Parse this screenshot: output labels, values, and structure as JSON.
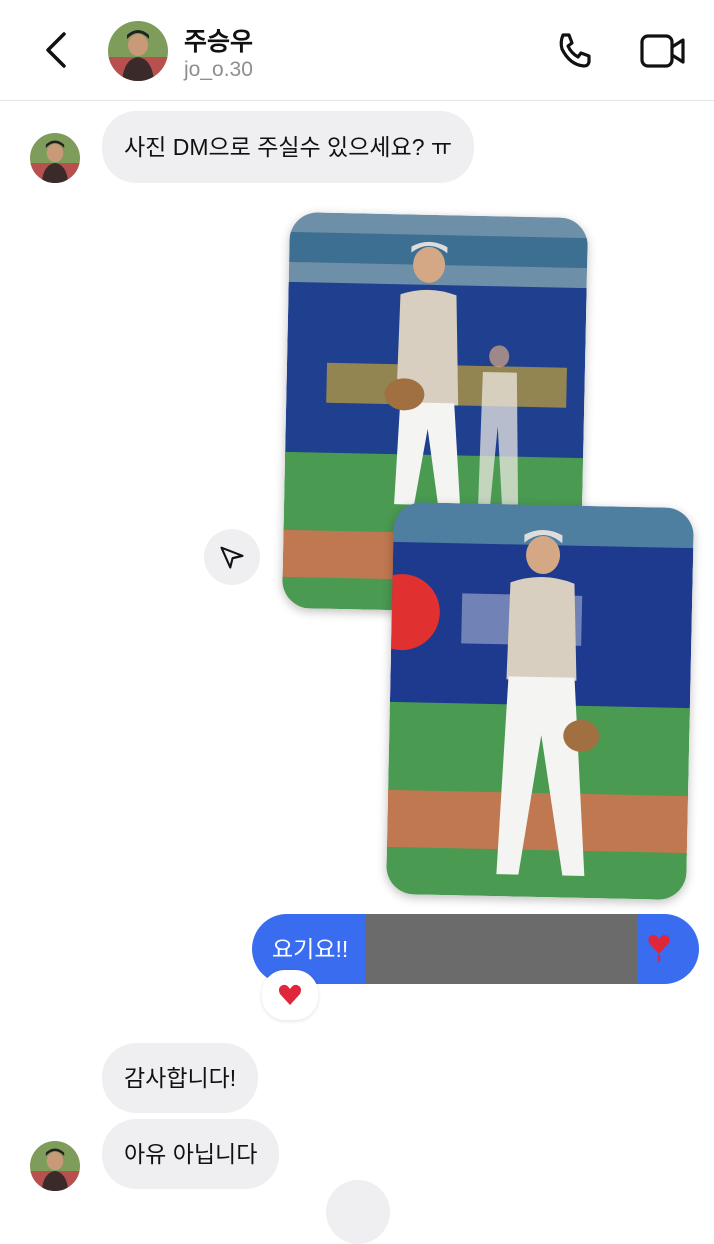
{
  "header": {
    "contact_name": "주승우",
    "contact_handle": "jo_o.30"
  },
  "messages": [
    {
      "from": "them",
      "text": "사진 DM으로 주실수 있으세요? ㅠ"
    },
    {
      "from": "me",
      "type": "photos",
      "count": 2
    },
    {
      "from": "me",
      "text": "요기요!!",
      "redacted": true,
      "reaction": "❤️"
    },
    {
      "from": "them",
      "text": "감사합니다!"
    },
    {
      "from": "them",
      "text": "아유 아닙니다"
    }
  ],
  "colors": {
    "outgoing_bubble": "#3a6cf0",
    "incoming_bubble": "#efeff1",
    "heart": "#e0263a"
  },
  "icons": {
    "back": "chevron-left-icon",
    "call": "phone-icon",
    "video": "video-camera-icon",
    "share": "send-icon",
    "reaction": "heart-icon"
  }
}
